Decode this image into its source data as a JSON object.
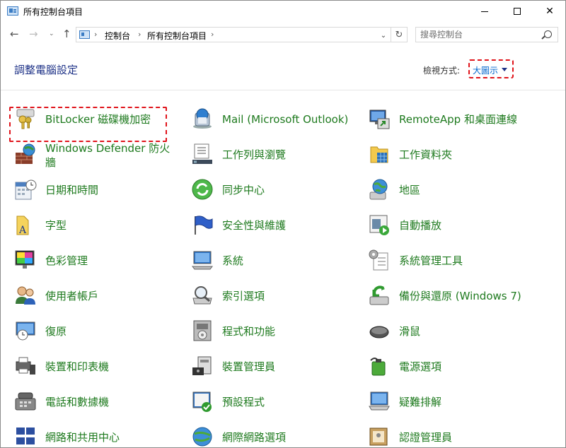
{
  "window": {
    "title": "所有控制台項目",
    "minimize_label": "",
    "maximize_label": "",
    "close_label": "✕"
  },
  "navigation": {
    "back_icon": "←",
    "forward_icon": "→",
    "recent_icon": "⌄",
    "up_icon": "↑",
    "breadcrumbs": [
      "控制台",
      "所有控制台項目"
    ],
    "refresh_icon": "↻",
    "dropdown_icon": "⌄"
  },
  "search": {
    "placeholder": "搜尋控制台"
  },
  "header": {
    "title": "調整電腦設定",
    "view_by_label": "檢視方式:",
    "view_by_value": "大圖示"
  },
  "items": [
    {
      "label": "BitLocker 磁碟機加密",
      "icon": "bitlocker-keys-icon",
      "highlighted": true
    },
    {
      "label": "Mail (Microsoft Outlook)",
      "icon": "mail-icon"
    },
    {
      "label": "RemoteApp 和桌面連線",
      "icon": "remoteapp-icon"
    },
    {
      "label": "Windows Defender 防火牆",
      "icon": "firewall-icon"
    },
    {
      "label": "工作列與瀏覽",
      "icon": "taskbar-icon"
    },
    {
      "label": "工作資料夾",
      "icon": "work-folders-icon"
    },
    {
      "label": "日期和時間",
      "icon": "date-time-icon"
    },
    {
      "label": "同步中心",
      "icon": "sync-center-icon"
    },
    {
      "label": "地區",
      "icon": "region-icon"
    },
    {
      "label": "字型",
      "icon": "fonts-icon"
    },
    {
      "label": "安全性與維護",
      "icon": "security-flag-icon"
    },
    {
      "label": "自動播放",
      "icon": "autoplay-icon"
    },
    {
      "label": "色彩管理",
      "icon": "color-management-icon"
    },
    {
      "label": "系統",
      "icon": "system-icon"
    },
    {
      "label": "系統管理工具",
      "icon": "admin-tools-icon"
    },
    {
      "label": "使用者帳戶",
      "icon": "user-accounts-icon"
    },
    {
      "label": "索引選項",
      "icon": "indexing-icon"
    },
    {
      "label": "備份與還原 (Windows 7)",
      "icon": "backup-restore-icon"
    },
    {
      "label": "復原",
      "icon": "recovery-icon"
    },
    {
      "label": "程式和功能",
      "icon": "programs-icon"
    },
    {
      "label": "滑鼠",
      "icon": "mouse-icon"
    },
    {
      "label": "裝置和印表機",
      "icon": "printer-icon"
    },
    {
      "label": "裝置管理員",
      "icon": "device-manager-icon"
    },
    {
      "label": "電源選項",
      "icon": "power-options-icon"
    },
    {
      "label": "電話和數據機",
      "icon": "phone-modem-icon"
    },
    {
      "label": "預設程式",
      "icon": "default-programs-icon"
    },
    {
      "label": "疑難排解",
      "icon": "troubleshooting-icon"
    },
    {
      "label": "網路和共用中心",
      "icon": "network-icon"
    },
    {
      "label": "網際網路選項",
      "icon": "internet-options-icon"
    },
    {
      "label": "認證管理員",
      "icon": "credential-manager-icon"
    }
  ],
  "colors": {
    "link_green": "#1e7a1e",
    "title_blue": "#1e3287",
    "view_value_blue": "#0066cc",
    "highlight_red": "#e0141b"
  }
}
